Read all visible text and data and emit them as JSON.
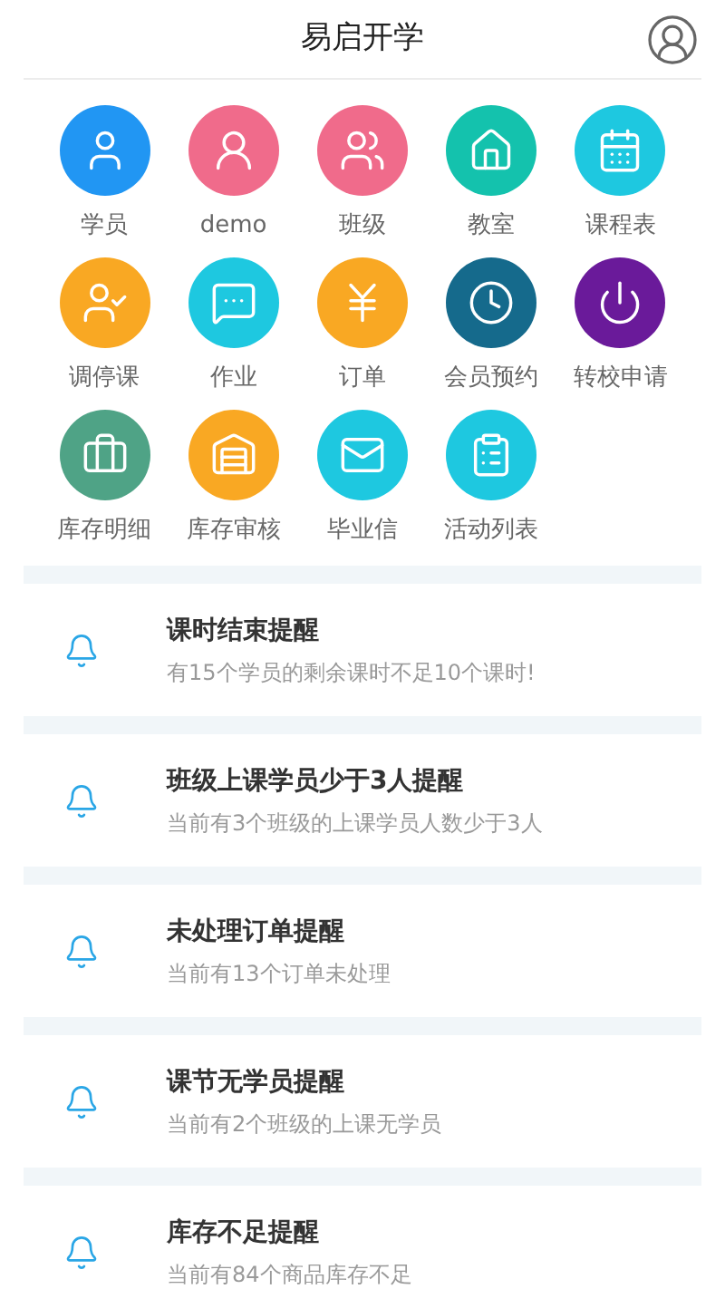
{
  "header": {
    "title": "易启开学"
  },
  "menu": [
    {
      "label": "学员",
      "color": "#2196f3"
    },
    {
      "label": "demo",
      "color": "#f06b8b"
    },
    {
      "label": "班级",
      "color": "#f06b8b"
    },
    {
      "label": "教室",
      "color": "#14c2ad"
    },
    {
      "label": "课程表",
      "color": "#1ec8e0"
    },
    {
      "label": "调停课",
      "color": "#f9a823"
    },
    {
      "label": "作业",
      "color": "#1ec8e0"
    },
    {
      "label": "订单",
      "color": "#f9a823"
    },
    {
      "label": "会员预约",
      "color": "#156a8c"
    },
    {
      "label": "转校申请",
      "color": "#6a1a9a"
    },
    {
      "label": "库存明细",
      "color": "#4fa386"
    },
    {
      "label": "库存审核",
      "color": "#f9a823"
    },
    {
      "label": "毕业信",
      "color": "#1ec8e0"
    },
    {
      "label": "活动列表",
      "color": "#1ec8e0"
    }
  ],
  "reminders": [
    {
      "title": "课时结束提醒",
      "detail": "有15个学员的剩余课时不足10个课时!"
    },
    {
      "title": "班级上课学员少于3人提醒",
      "detail": "当前有3个班级的上课学员人数少于3人"
    },
    {
      "title": "未处理订单提醒",
      "detail": "当前有13个订单未处理"
    },
    {
      "title": "课节无学员提醒",
      "detail": "当前有2个班级的上课无学员"
    },
    {
      "title": "库存不足提醒",
      "detail": "当前有84个商品库存不足"
    }
  ]
}
